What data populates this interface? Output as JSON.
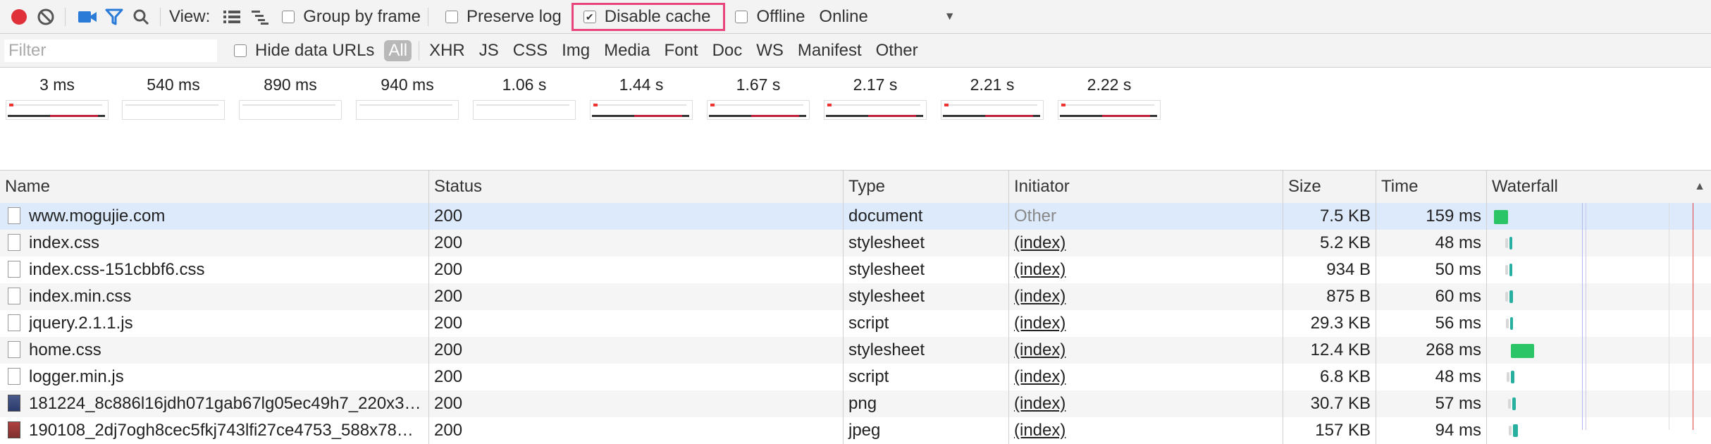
{
  "toolbar": {
    "view_label": "View:",
    "group_by_frame": {
      "label": "Group by frame",
      "checked": false
    },
    "preserve_log": {
      "label": "Preserve log",
      "checked": false
    },
    "disable_cache": {
      "label": "Disable cache",
      "checked": true,
      "check_glyph": "✔"
    },
    "offline": {
      "label": "Offline",
      "checked": false
    },
    "throttle": {
      "value": "Online",
      "arrow": "▼"
    },
    "colors": {
      "record": "#e0303a",
      "accent": "#2a7ad8",
      "highlight": "#e8457a"
    }
  },
  "filterbar": {
    "placeholder": "Filter",
    "hide_data_urls": {
      "label": "Hide data URLs",
      "checked": false
    },
    "types": [
      "All",
      "XHR",
      "JS",
      "CSS",
      "Img",
      "Media",
      "Font",
      "Doc",
      "WS",
      "Manifest",
      "Other"
    ],
    "active_type": "All"
  },
  "overview": {
    "frames": [
      "3 ms",
      "540 ms",
      "890 ms",
      "940 ms",
      "1.06 s",
      "1.44 s",
      "1.67 s",
      "2.17 s",
      "2.21 s",
      "2.22 s"
    ]
  },
  "table": {
    "columns": {
      "name": "Name",
      "status": "Status",
      "type": "Type",
      "initiator": "Initiator",
      "size": "Size",
      "time": "Time",
      "waterfall": "Waterfall",
      "sort_arrow": "▲"
    },
    "rows": [
      {
        "name": "www.mogujie.com",
        "status": "200",
        "type": "document",
        "initiator": "Other",
        "size": "7.5 KB",
        "time": "159 ms",
        "icon": "document-icon"
      },
      {
        "name": "index.css",
        "status": "200",
        "type": "stylesheet",
        "initiator": "(index)",
        "size": "5.2 KB",
        "time": "48 ms",
        "icon": "document-icon"
      },
      {
        "name": "index.css-151cbbf6.css",
        "status": "200",
        "type": "stylesheet",
        "initiator": "(index)",
        "size": "934 B",
        "time": "50 ms",
        "icon": "document-icon"
      },
      {
        "name": "index.min.css",
        "status": "200",
        "type": "stylesheet",
        "initiator": "(index)",
        "size": "875 B",
        "time": "60 ms",
        "icon": "document-icon"
      },
      {
        "name": "jquery.2.1.1.js",
        "status": "200",
        "type": "script",
        "initiator": "(index)",
        "size": "29.3 KB",
        "time": "56 ms",
        "icon": "document-icon"
      },
      {
        "name": "home.css",
        "status": "200",
        "type": "stylesheet",
        "initiator": "(index)",
        "size": "12.4 KB",
        "time": "268 ms",
        "icon": "document-icon"
      },
      {
        "name": "logger.min.js",
        "status": "200",
        "type": "script",
        "initiator": "(index)",
        "size": "6.8 KB",
        "time": "48 ms",
        "icon": "document-icon"
      },
      {
        "name": "181224_8c886l16jdh071gab67lg05ec49h7_220x3…",
        "status": "200",
        "type": "png",
        "initiator": "(index)",
        "size": "30.7 KB",
        "time": "57 ms",
        "icon": "image-thumbnail-icon"
      },
      {
        "name": "190108_2dj7ogh8cec5fkj743lfi27ce4753_588x78…",
        "status": "200",
        "type": "jpeg",
        "initiator": "(index)",
        "size": "157 KB",
        "time": "94 ms",
        "icon": "image-thumbnail-icon"
      }
    ]
  }
}
